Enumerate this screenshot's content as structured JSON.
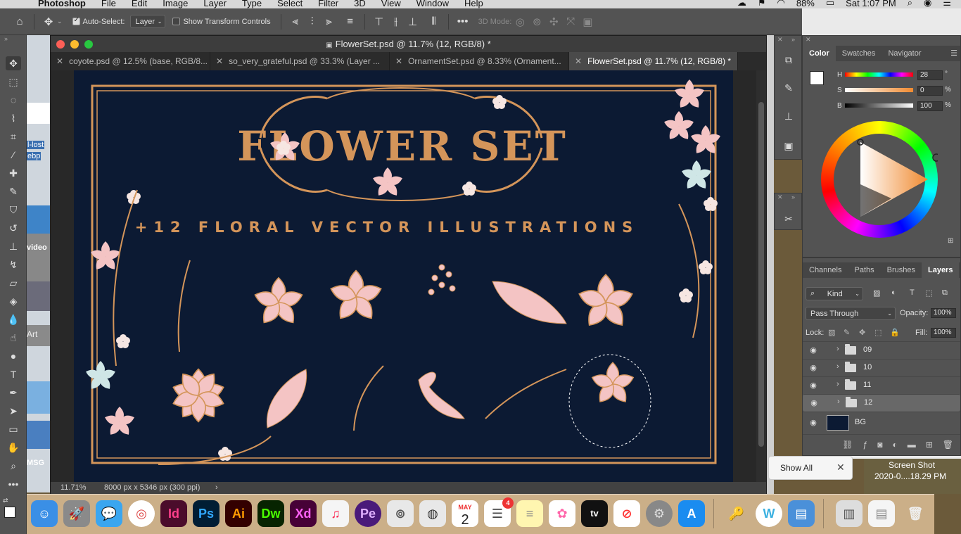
{
  "menubar": {
    "app_name": "Photoshop",
    "menus": [
      "File",
      "Edit",
      "Image",
      "Layer",
      "Type",
      "Select",
      "Filter",
      "3D",
      "View",
      "Window",
      "Help"
    ],
    "battery": "88%",
    "clock": "Sat 1:07 PM"
  },
  "options": {
    "auto_select_label": "Auto-Select:",
    "auto_select_value": "Layer",
    "show_transform_label": "Show Transform Controls",
    "mode_3d_label": "3D Mode:"
  },
  "document": {
    "title": "FlowerSet.psd @ 11.7% (12, RGB/8) *",
    "tabs": [
      {
        "label": "coyote.psd @ 12.5% (base, RGB/8...",
        "active": false
      },
      {
        "label": "so_very_grateful.psd @ 33.3% (Layer ...",
        "active": false
      },
      {
        "label": "OrnamentSet.psd @ 8.33% (Ornament...",
        "active": false
      },
      {
        "label": "FlowerSet.psd @ 11.7% (12, RGB/8) *",
        "active": true
      }
    ],
    "zoom": "11.71%",
    "dimensions": "8000 px x 5346 px (300 ppi)"
  },
  "artwork": {
    "title": "FLOWER SET",
    "subtitle": "+12 FLORAL VECTOR ILLUSTRATIONS",
    "background_color": "#0c1a33",
    "accent_color": "#d4955a",
    "flower_color": "#f4c4c4"
  },
  "desktop_left_labels": [
    "l-lost",
    "ebp",
    "video",
    "Art",
    "MSG"
  ],
  "color_panel": {
    "tabs": [
      "Color",
      "Swatches",
      "Navigator"
    ],
    "h_label": "H",
    "s_label": "S",
    "b_label": "B",
    "h_value": "28",
    "s_value": "0",
    "b_value": "100",
    "h_unit": "°",
    "s_unit": "%",
    "b_unit": "%"
  },
  "layers_panel": {
    "tabs": [
      "Channels",
      "Paths",
      "Brushes",
      "Layers"
    ],
    "filter_kind": "Kind",
    "blend_mode": "Pass Through",
    "opacity_label": "Opacity:",
    "opacity_value": "100%",
    "lock_label": "Lock:",
    "fill_label": "Fill:",
    "fill_value": "100%",
    "layers": [
      {
        "name": "09",
        "type": "group",
        "selected": false
      },
      {
        "name": "10",
        "type": "group",
        "selected": false
      },
      {
        "name": "11",
        "type": "group",
        "selected": false
      },
      {
        "name": "12",
        "type": "group",
        "selected": true
      },
      {
        "name": "BG",
        "type": "layer",
        "selected": false
      }
    ]
  },
  "desktop": {
    "show_all": "Show All",
    "screenshot_name_1": "Screen Shot",
    "screenshot_name_2": "2020-0....18.29 PM"
  },
  "dock_apps": [
    "Finder",
    "Launchpad",
    "Messages",
    "Chrome",
    "InDesign",
    "Photoshop",
    "Illustrator",
    "Dreamweaver",
    "XD",
    "Music",
    "Premiere Elements",
    "Links",
    "Lasso",
    "Calendar",
    "Reminders",
    "Notes",
    "Photos",
    "Apple TV",
    "News",
    "System Preferences",
    "App Store"
  ],
  "dock_labels": {
    "id": "Id",
    "ps": "Ps",
    "ai": "Ai",
    "dw": "Dw",
    "xd": "Xd",
    "pe": "Pe",
    "cal_month": "MAY",
    "cal_day": "2",
    "reminders_badge": "4",
    "appletv": "tv"
  }
}
